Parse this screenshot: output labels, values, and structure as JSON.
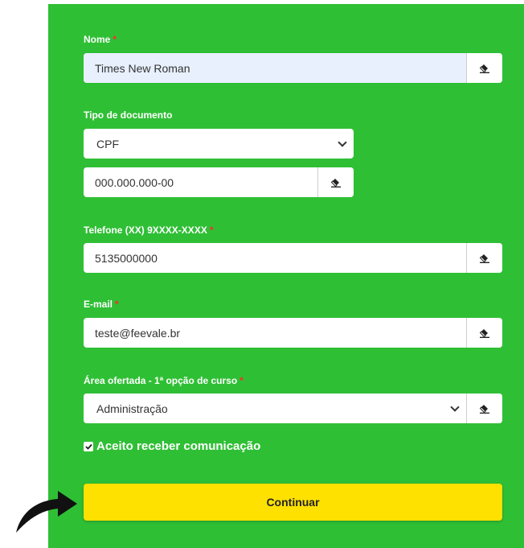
{
  "form": {
    "name": {
      "label": "Nome",
      "required_mark": "*",
      "value": "Times New Roman"
    },
    "doc_type": {
      "label": "Tipo de documento",
      "selected": "CPF"
    },
    "doc_number": {
      "placeholder": "000.000.000-00"
    },
    "phone": {
      "label": "Telefone (XX) 9XXXX-XXXX",
      "required_mark": "*",
      "value": "5135000000"
    },
    "email": {
      "label": "E-mail",
      "required_mark": "*",
      "value": "teste@feevale.br"
    },
    "course_area": {
      "label": "Área ofertada - 1ª opção de curso",
      "required_mark": "*",
      "selected": "Administração"
    },
    "consent": {
      "label": "Aceito receber comunicação",
      "checked": true
    },
    "submit_label": "Continuar"
  },
  "icons": {
    "clear": "eraser-icon",
    "dropdown": "chevron-down-icon",
    "check": "checkmark-icon",
    "pointer": "curved-arrow-icon"
  },
  "colors": {
    "panel_bg": "#2fbf35",
    "button_bg": "#ffe100",
    "required": "#ff2a2a",
    "autofill_bg": "#e8f0fe"
  }
}
